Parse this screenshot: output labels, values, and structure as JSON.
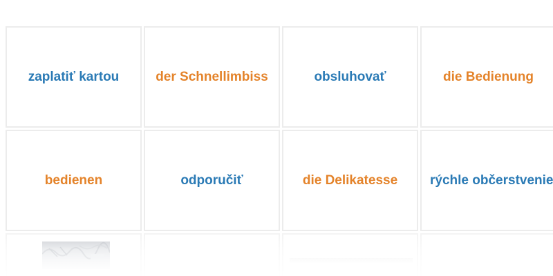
{
  "cards": [
    {
      "text": "zaplatiť kartou",
      "lang": "sk"
    },
    {
      "text": "der Schnellimbiss",
      "lang": "de"
    },
    {
      "text": "obsluhovať",
      "lang": "sk"
    },
    {
      "text": "die Bedienung",
      "lang": "de"
    },
    {
      "text": "bedienen",
      "lang": "de"
    },
    {
      "text": "odporučiť",
      "lang": "sk"
    },
    {
      "text": "die Delikatesse",
      "lang": "de"
    },
    {
      "text": "rýchle občerstvenie",
      "lang": "sk"
    }
  ],
  "colors": {
    "slovak": "#2a7ab5",
    "german": "#e4832a",
    "card_border": "#ececec"
  }
}
